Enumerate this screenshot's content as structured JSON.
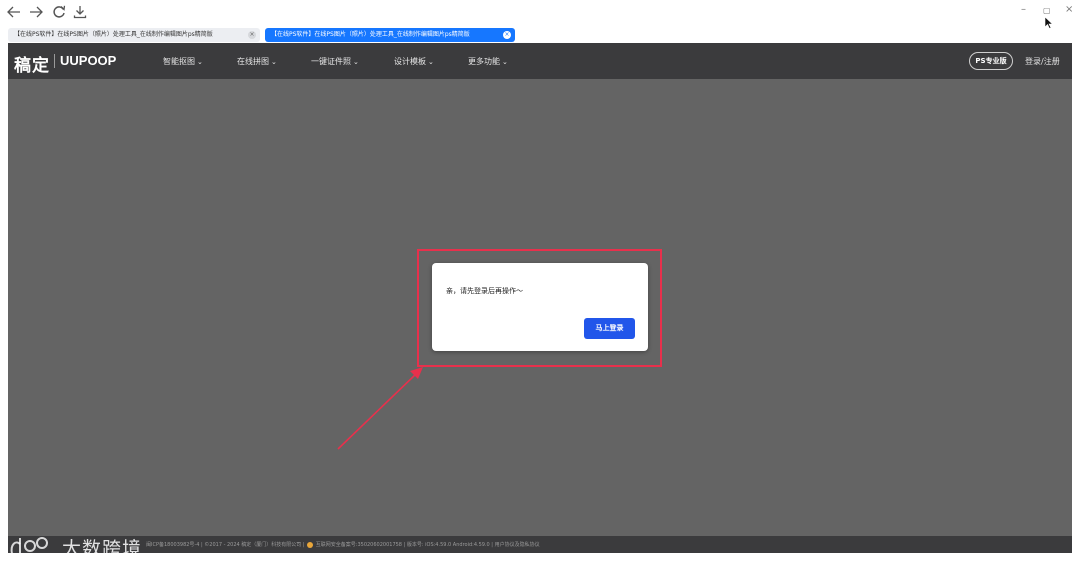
{
  "browser": {
    "tabs": [
      {
        "title": "【在线PS软件】在线PS图片（照片）处理工具_在线制作编辑图片ps精简版",
        "active": false
      },
      {
        "title": "【在线PS软件】在线PS图片（照片）处理工具_在线制作编辑图片ps精简版",
        "active": true
      }
    ],
    "window_controls": {
      "minimize": "–",
      "restore": "▢",
      "close": "×"
    }
  },
  "header": {
    "logo_cn": "稿定",
    "logo_en": "UUPOOP",
    "nav": [
      {
        "label": "智能抠图"
      },
      {
        "label": "在线拼图"
      },
      {
        "label": "一键证件照"
      },
      {
        "label": "设计模板"
      },
      {
        "label": "更多功能"
      }
    ],
    "pro_button": "PS专业版",
    "login": "登录/注册"
  },
  "modal": {
    "message": "亲，请先登录后再操作～",
    "button": "马上登录"
  },
  "footer": {
    "text_before_badge": "闽ICP备18003982号-4 | ©2017 - 2024 稿定（厦门）科技有限公司 |",
    "text_after_badge": "互联网安全备案号:35020602001758 | 版本号: iOS:4.59.0  Android:4.59.0 | 用户协议及隐私协议"
  },
  "watermark": {
    "text": "大数跨境"
  },
  "colors": {
    "header_bg": "#3b3b3d",
    "overlay_bg": "#646464",
    "primary_button": "#2156ea",
    "highlight": "#e8304c",
    "active_tab": "#1677ff"
  }
}
